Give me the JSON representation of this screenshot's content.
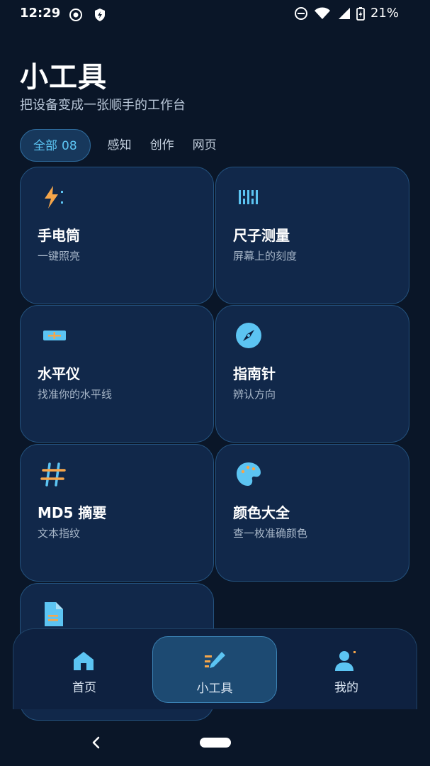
{
  "status_bar": {
    "time": "12:29",
    "battery_percent": "21%",
    "icons": [
      "record-icon",
      "shield-bolt-icon",
      "do-not-disturb-icon",
      "wifi-icon",
      "signal-icon",
      "battery-charging-icon"
    ]
  },
  "header": {
    "title": "小工具",
    "subtitle": "把设备变成一张顺手的工作台"
  },
  "filters": [
    {
      "label": "全部",
      "count": "08",
      "active": true
    },
    {
      "label": "感知",
      "active": false
    },
    {
      "label": "创作",
      "active": false
    },
    {
      "label": "网页",
      "active": false
    }
  ],
  "tools": [
    {
      "title": "手电筒",
      "desc": "一键照亮",
      "icon": "flashlight-icon"
    },
    {
      "title": "尺子测量",
      "desc": "屏幕上的刻度",
      "icon": "ruler-icon"
    },
    {
      "title": "水平仪",
      "desc": "找准你的水平线",
      "icon": "level-icon"
    },
    {
      "title": "指南针",
      "desc": "辨认方向",
      "icon": "compass-icon"
    },
    {
      "title": "MD5 摘要",
      "desc": "文本指纹",
      "icon": "hash-icon"
    },
    {
      "title": "颜色大全",
      "desc": "查一枚准确颜色",
      "icon": "palette-icon"
    },
    {
      "title": "",
      "desc": "",
      "icon": "document-icon"
    }
  ],
  "bottom_nav": [
    {
      "label": "首页",
      "icon": "home-icon",
      "active": false
    },
    {
      "label": "小工具",
      "icon": "tools-icon",
      "active": true
    },
    {
      "label": "我的",
      "icon": "profile-icon",
      "active": false
    }
  ],
  "colors": {
    "background": "#0a1628",
    "card": "#11284a",
    "accent": "#5cc4f2",
    "orange": "#f6a64a"
  }
}
